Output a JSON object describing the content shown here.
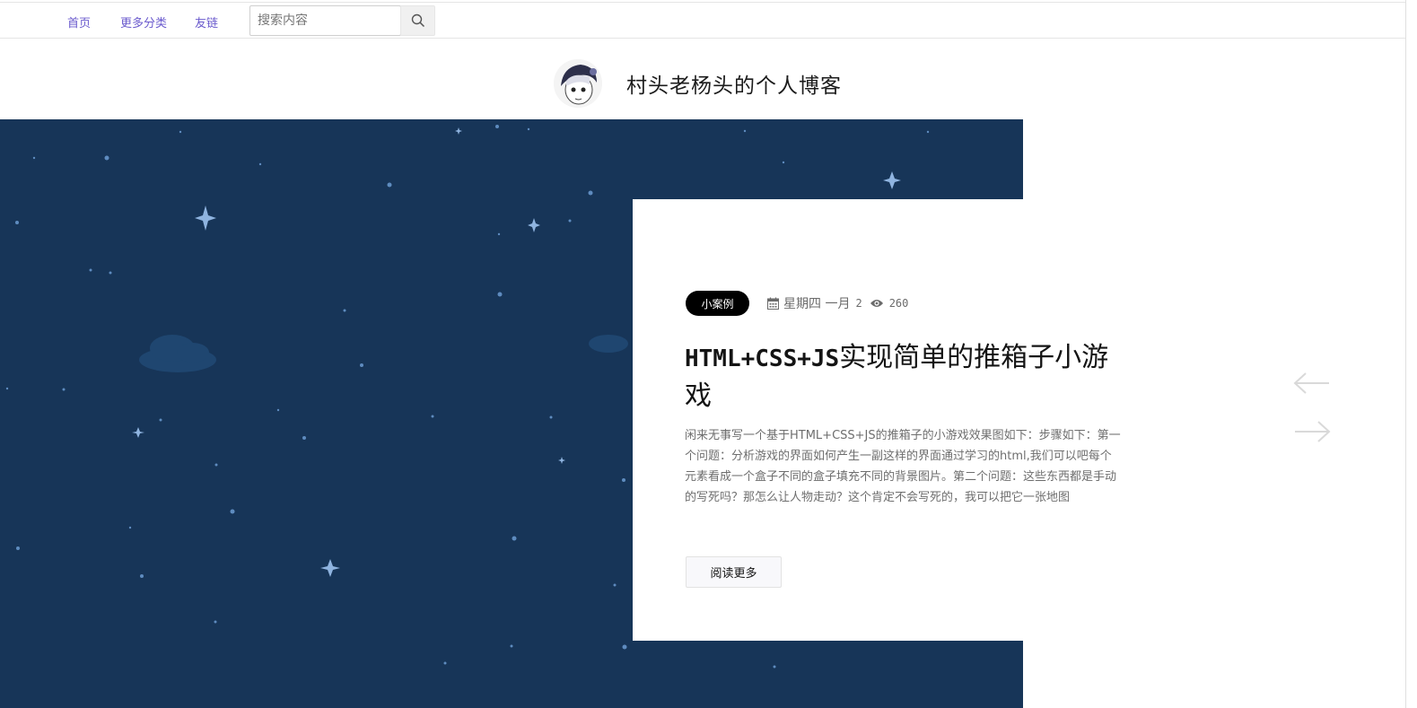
{
  "nav": {
    "links": [
      "首页",
      "更多分类",
      "友链"
    ],
    "search_placeholder": "搜索内容"
  },
  "header": {
    "title": "村头老杨头的个人博客"
  },
  "post": {
    "category": "小案例",
    "date": "星期四 一月",
    "day": "2",
    "views": "260",
    "title_en": "HTML+CSS+JS",
    "title_cn": "实现简单的推箱子小游戏",
    "excerpt": "闲来无事写一个基于HTML+CSS+JS的推箱子的小游戏效果图如下：步骤如下：第一个问题：分析游戏的界面如何产生一副这样的界面通过学习的html,我们可以吧每个元素看成一个盒子不同的盒子填充不同的背景图片。第二个问题：这些东西都是手动的写死吗？那怎么让人物走动？这个肯定不会写死的，我可以把它一张地图",
    "read_more": "阅读更多"
  },
  "colors": {
    "hero_bg": "#173558",
    "nav_link": "#6a5acd",
    "tag_bg": "#000000"
  }
}
